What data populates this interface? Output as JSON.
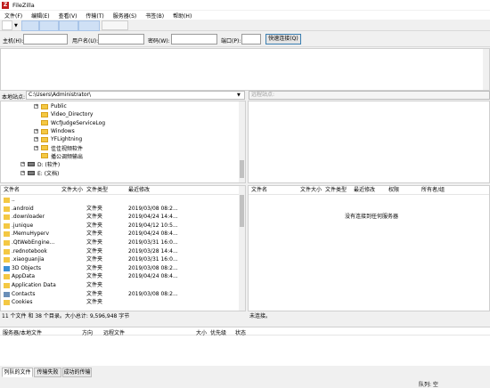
{
  "window": {
    "title": "FileZilla"
  },
  "menu": [
    "文件(F)",
    "编辑(E)",
    "查看(V)",
    "传输(T)",
    "服务器(S)",
    "书签(B)",
    "帮助(H)"
  ],
  "quickconnect": {
    "host_label": "主机(H):",
    "user_label": "用户名(U):",
    "pass_label": "密码(W):",
    "port_label": "端口(P):",
    "button": "快速连接(Q)"
  },
  "local": {
    "site_label": "本地站点:",
    "site_path": "C:\\Users\\Administrator\\"
  },
  "remote": {
    "site_label": "远程站点:"
  },
  "tree": [
    {
      "label": "Public",
      "expand": "+",
      "indent": 1
    },
    {
      "label": "Video_Directory",
      "expand": "",
      "indent": 1
    },
    {
      "label": "WcfJudgeServiceLog",
      "expand": "",
      "indent": 1
    },
    {
      "label": "Windows",
      "expand": "+",
      "indent": 1
    },
    {
      "label": "YFLightning",
      "expand": "+",
      "indent": 1
    },
    {
      "label": "佳佳视频软件",
      "expand": "+",
      "indent": 1
    },
    {
      "label": "播公调频输出",
      "expand": "",
      "indent": 1
    },
    {
      "label": "D: (软件)",
      "expand": "+",
      "indent": 0,
      "drive": true
    },
    {
      "label": "E: (文档)",
      "expand": "+",
      "indent": 0,
      "drive": true
    }
  ],
  "local_headers": {
    "name": "文件名",
    "size": "文件大小",
    "type": "文件类型",
    "modified": "最近修改"
  },
  "local_files": [
    {
      "name": "..",
      "type": "",
      "date": ""
    },
    {
      "name": ".android",
      "type": "文件夹",
      "date": "2019/03/08 08:2..."
    },
    {
      "name": ".downloader",
      "type": "文件夹",
      "date": "2019/04/24 14:4..."
    },
    {
      "name": ".junique",
      "type": "文件夹",
      "date": "2019/04/12 10:5..."
    },
    {
      "name": ".MemuHyperv",
      "type": "文件夹",
      "date": "2019/04/24 08:4..."
    },
    {
      "name": ".QtWebEngine...",
      "type": "文件夹",
      "date": "2019/03/31 16:0..."
    },
    {
      "name": ".rednotebook",
      "type": "文件夹",
      "date": "2019/03/28 14:4..."
    },
    {
      "name": ".xiaoguanjia",
      "type": "文件夹",
      "date": "2019/03/31 16:0..."
    },
    {
      "name": "3D Objects",
      "type": "文件夹",
      "date": "2019/03/08 08:2..."
    },
    {
      "name": "AppData",
      "type": "文件夹",
      "date": "2019/04/24 08:4..."
    },
    {
      "name": "Application Data",
      "type": "文件夹",
      "date": ""
    },
    {
      "name": "Contacts",
      "type": "文件夹",
      "date": "2019/03/08 08:2..."
    },
    {
      "name": "Cookies",
      "type": "文件夹",
      "date": ""
    }
  ],
  "remote_headers": {
    "name": "文件名",
    "size": "文件大小",
    "type": "文件类型",
    "modified": "最近修改",
    "perms": "权限",
    "owner": "所有者/组"
  },
  "remote_empty": "没有连接到任何服务器",
  "local_status": "11 个文件 和 38 个目录。大小总计: 9,596,948 字节",
  "remote_status": "未连接。",
  "queue_headers": {
    "server": "服务器/本地文件",
    "dir": "方向",
    "remote": "远程文件",
    "size": "大小",
    "priority": "优先级",
    "status": "状态"
  },
  "tabs": [
    "列队的文件",
    "传输失败",
    "成功的传输"
  ],
  "queue_status": "队列: 空",
  "colors": {
    "accent": "#3c7fb1",
    "toolbar_blue": "#cfe0f5",
    "folder": "#f4c843"
  }
}
